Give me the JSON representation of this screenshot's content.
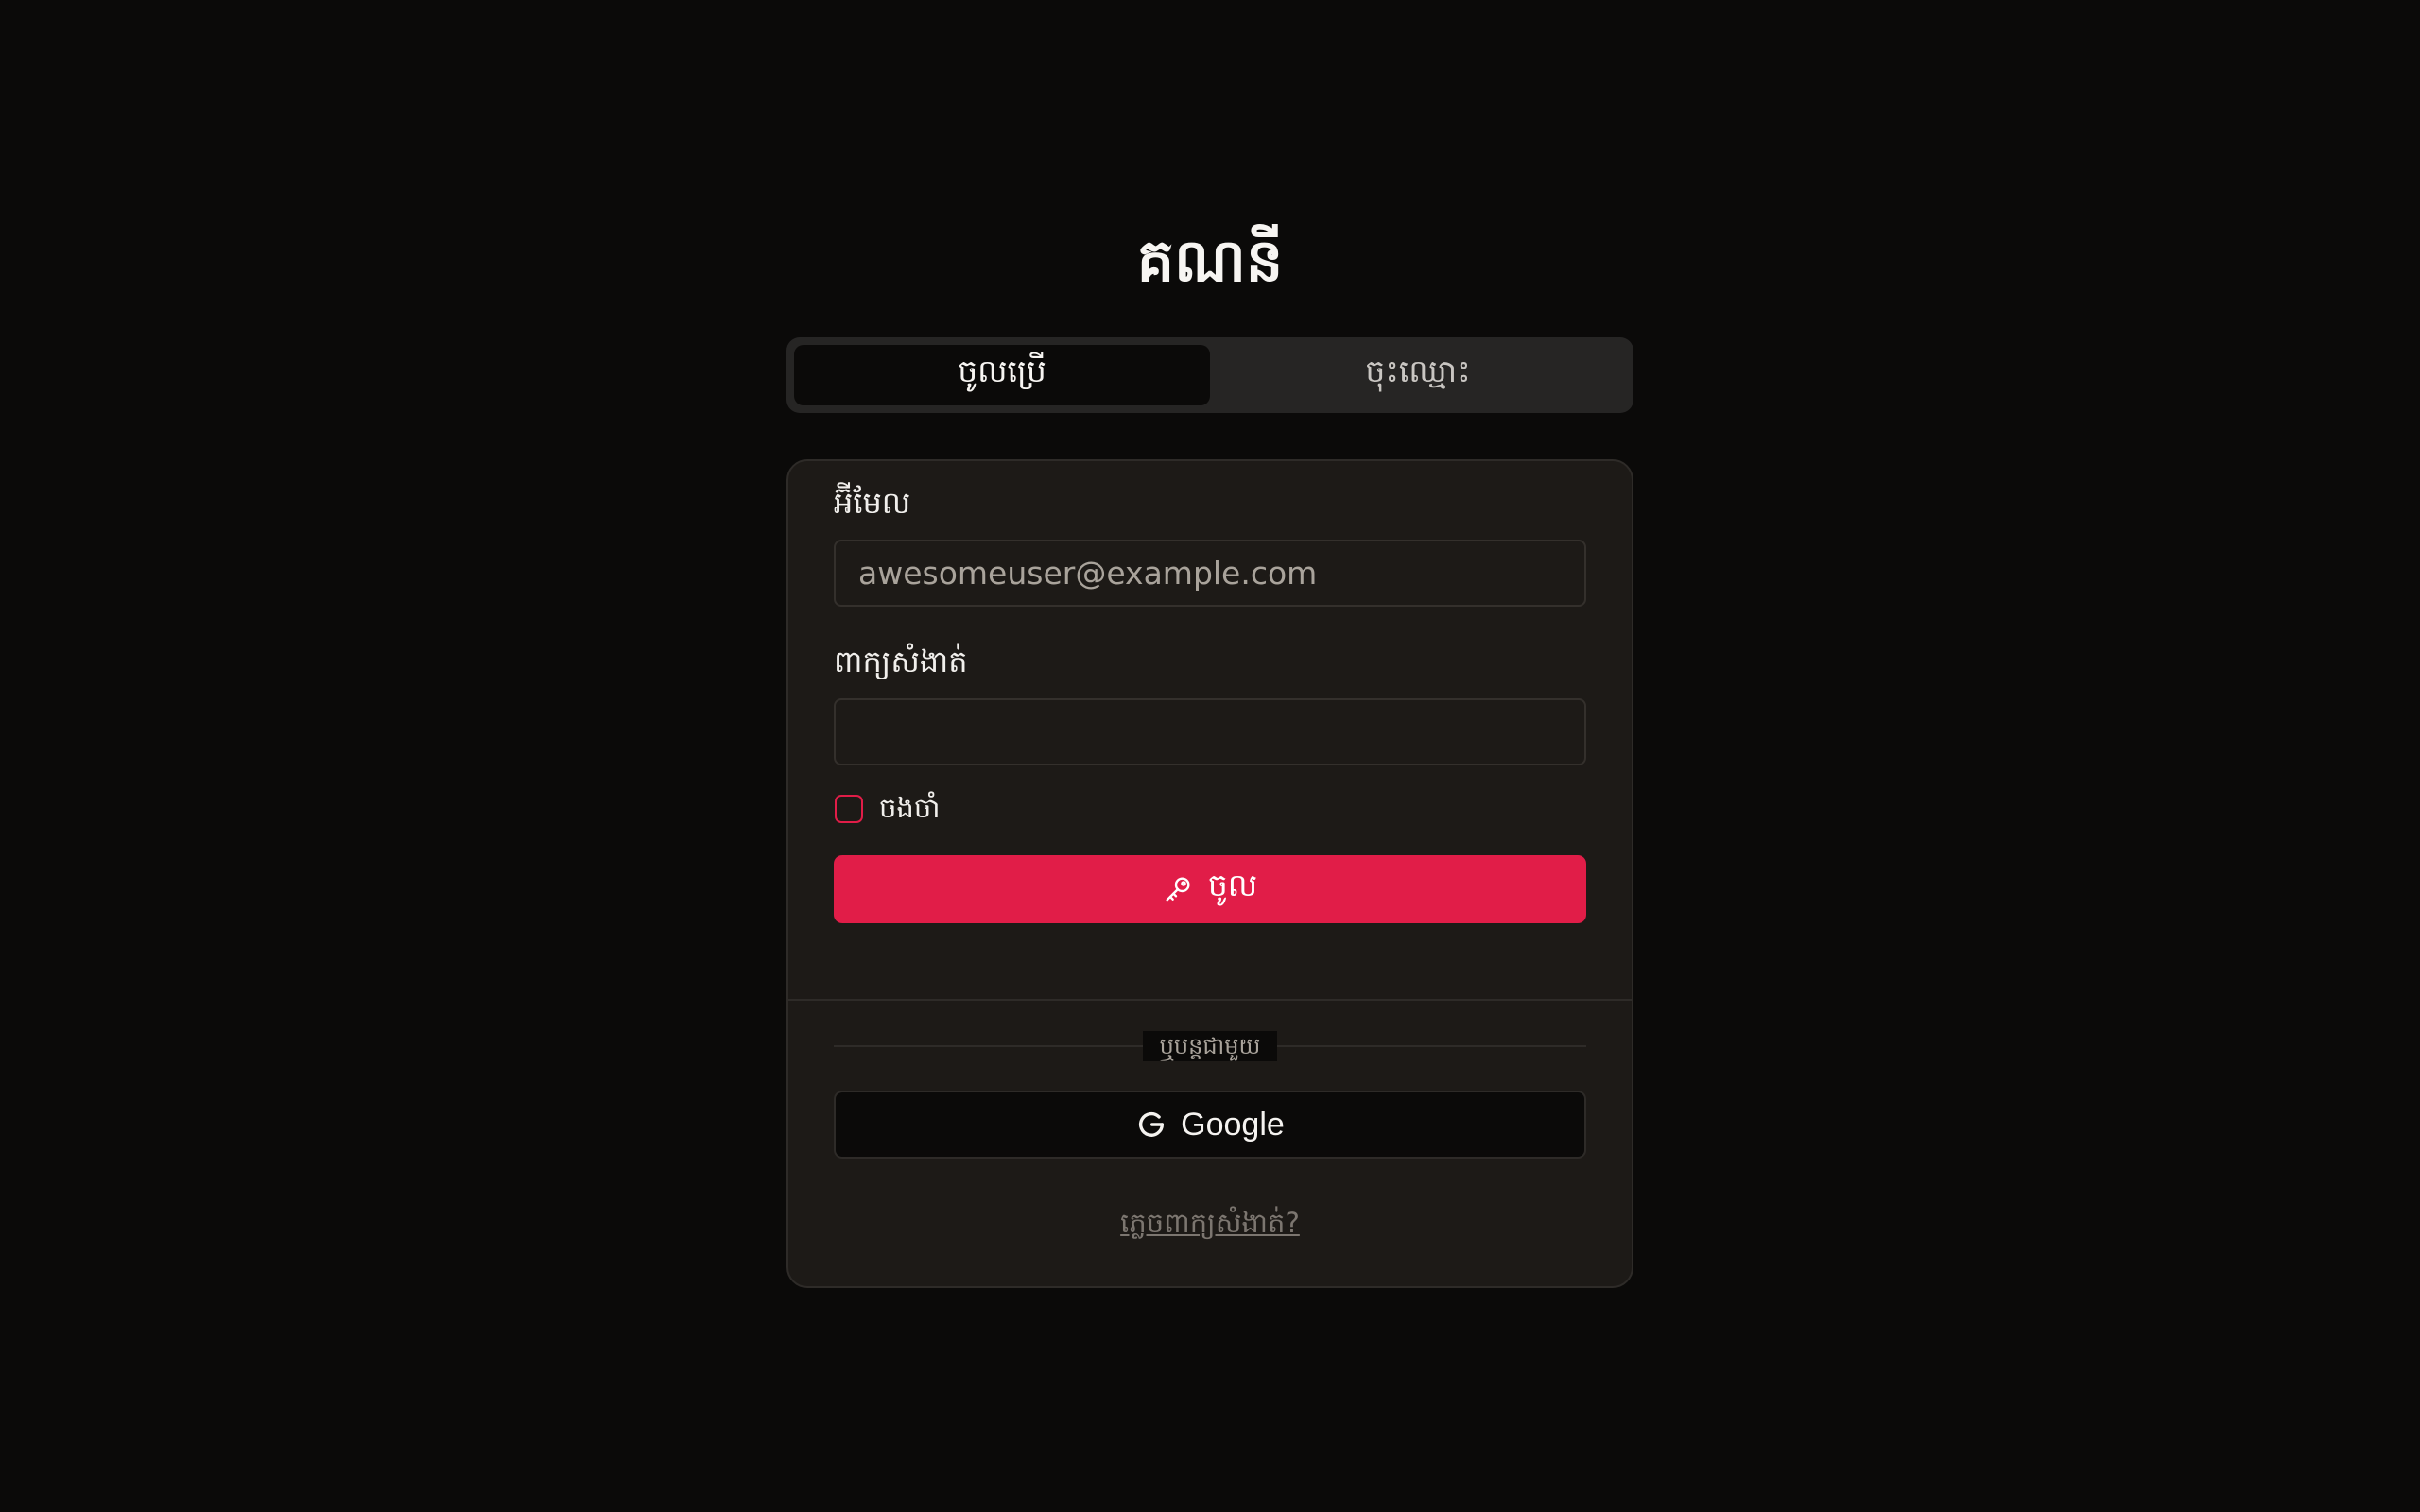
{
  "page_title": "គណនី",
  "tabs": [
    {
      "label": "ចូលប្រើ",
      "active": true
    },
    {
      "label": "ចុះឈ្មោះ",
      "active": false
    }
  ],
  "form": {
    "email_label": "អ៊ីមែល",
    "email_placeholder": "awesomeuser@example.com",
    "email_value": "",
    "password_label": "ពាក្យសំងាត់",
    "password_value": "",
    "remember_label": "ចងចាំ",
    "remember_checked": false,
    "submit_label": "ចូល",
    "submit_icon": "key-icon"
  },
  "alt_login": {
    "divider_text": "ឬបន្តជាមួយ",
    "google_label": "Google",
    "google_icon": "google-icon"
  },
  "forgot_password": "ភ្លេចពាក្យសំងាត់?",
  "colors": {
    "accent": "#e11d48",
    "background": "#0b0a09",
    "card": "#1d1a17",
    "muted_text": "#7c7670"
  }
}
